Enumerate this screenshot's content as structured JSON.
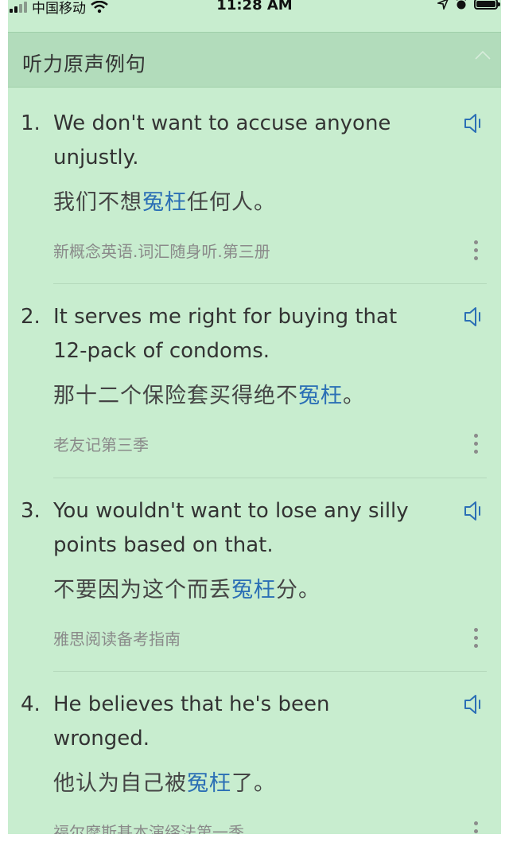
{
  "status_bar": {
    "carrier": "中国移动",
    "time": "11:28 AM"
  },
  "section": {
    "title": "听力原声例句"
  },
  "sentences": [
    {
      "number": "1.",
      "en_line1": "We don't want to accuse anyone",
      "en_line2": "unjustly.",
      "zh_before": "我们不想",
      "zh_highlight": "冤枉",
      "zh_after": "任何人。",
      "source": "新概念英语.词汇随身听.第三册"
    },
    {
      "number": "2.",
      "en_line1": "It serves me right for buying that",
      "en_line2": "12-pack of condoms.",
      "zh_before": "那十二个保险套买得绝不",
      "zh_highlight": "冤枉",
      "zh_after": "。",
      "source": "老友记第三季"
    },
    {
      "number": "3.",
      "en_line1": "You wouldn't want to lose any silly",
      "en_line2": "points based on that.",
      "zh_before": "不要因为这个而丢",
      "zh_highlight": "冤枉",
      "zh_after": "分。",
      "source": "雅思阅读备考指南"
    },
    {
      "number": "4.",
      "en_line1": "He believes that he's been",
      "en_line2": "wronged.",
      "zh_before": "他认为自己被",
      "zh_highlight": "冤枉",
      "zh_after": "了。",
      "source": "福尔摩斯基本演绎法第一季"
    }
  ],
  "icons": {
    "speaker": "speaker-icon",
    "more": "more-vertical-icon",
    "collapse": "chevron-up-icon"
  },
  "colors": {
    "background": "#c8edcf",
    "header_background": "#b2dcbb",
    "highlight": "#2b6fb5",
    "speaker": "#2b6fb5"
  }
}
